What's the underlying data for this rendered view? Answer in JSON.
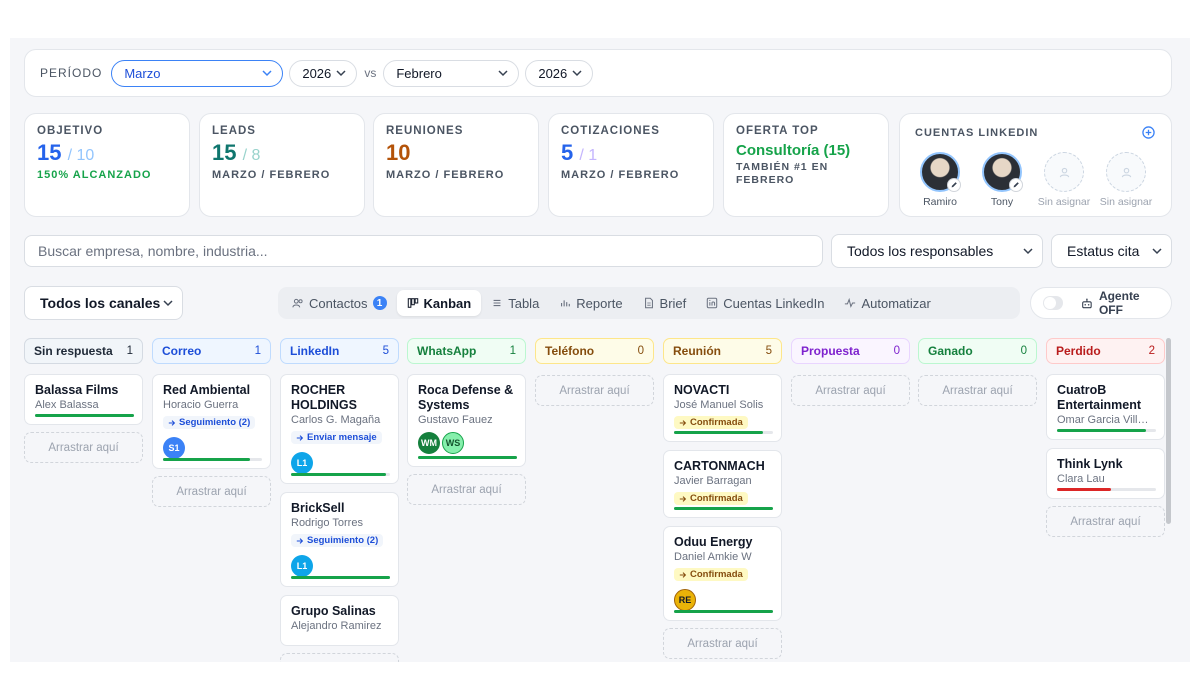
{
  "period": {
    "label": "PERÍODO",
    "month": "Marzo",
    "year": "2026",
    "vs": "vs",
    "compare_month": "Febrero",
    "compare_year": "2026"
  },
  "kpis": {
    "objetivo": {
      "title": "OBJETIVO",
      "value": "15",
      "denominator": "/ 10",
      "sub": "150% ALCANZADO"
    },
    "leads": {
      "title": "LEADS",
      "value": "15",
      "denominator": "/ 8",
      "sub": "MARZO / FEBRERO"
    },
    "reuniones": {
      "title": "REUNIONES",
      "value": "10",
      "sub": "MARZO / FEBRERO"
    },
    "cotizaciones": {
      "title": "COTIZACIONES",
      "value": "5",
      "denominator": "/ 1",
      "sub": "MARZO / FEBRERO"
    },
    "oferta": {
      "title": "OFERTA TOP",
      "value": "Consultoría (15)",
      "sub_line1": "TAMBIÉN #1 EN",
      "sub_line2": "FEBRERO"
    }
  },
  "linkedin": {
    "title": "CUENTAS LINKEDIN",
    "accounts": [
      "Ramiro",
      "Tony",
      "Sin asignar",
      "Sin asignar"
    ]
  },
  "search": {
    "placeholder": "Buscar empresa, nombre, industria..."
  },
  "filters": {
    "responsables": "Todos los responsables",
    "estatus": "Estatus cita",
    "canales": "Todos los canales"
  },
  "tabs": [
    {
      "label": "Contactos",
      "badge": "1"
    },
    {
      "label": "Kanban"
    },
    {
      "label": "Tabla"
    },
    {
      "label": "Reporte"
    },
    {
      "label": "Brief"
    },
    {
      "label": "Cuentas LinkedIn"
    },
    {
      "label": "Automatizar"
    }
  ],
  "agent": {
    "label": "Agente OFF"
  },
  "drop_label": "Arrastrar aquí",
  "colors": {
    "accent": "#3b82f6",
    "green": "#16a34a",
    "red": "#dc2626"
  },
  "columns": [
    {
      "name": "Sin respuesta",
      "count": "1",
      "cards": [
        {
          "title": "Balassa Films",
          "sub": "Alex Balassa",
          "progress": 1.0,
          "bar": "#16a34a"
        }
      ]
    },
    {
      "name": "Correo",
      "count": "1",
      "cards": [
        {
          "title": "Red Ambiental",
          "sub": "Horacio Guerra",
          "tag": "Seguimiento (2)",
          "chips": [
            "S1"
          ],
          "progress": 0.88,
          "bar": "#16a34a"
        }
      ]
    },
    {
      "name": "LinkedIn",
      "count": "5",
      "cards": [
        {
          "title": "ROCHER HOLDINGS",
          "sub": "Carlos G. Magaña",
          "tag": "Enviar mensaje",
          "chips": [
            "L1"
          ],
          "progress": 0.96,
          "bar": "#16a34a"
        },
        {
          "title": "BrickSell",
          "sub": "Rodrigo Torres",
          "tag": "Seguimiento (2)",
          "chips": [
            "L1"
          ],
          "progress": 1.0,
          "bar": "#16a34a"
        },
        {
          "title": "Grupo Salinas",
          "sub": "Alejandro Ramirez"
        }
      ]
    },
    {
      "name": "WhatsApp",
      "count": "1",
      "cards": [
        {
          "title": "Roca Defense & Systems",
          "sub": "Gustavo Fauez",
          "chips": [
            "WM",
            "WS"
          ],
          "progress": 1.0,
          "bar": "#16a34a"
        }
      ]
    },
    {
      "name": "Teléfono",
      "count": "0",
      "cards": []
    },
    {
      "name": "Reunión",
      "count": "5",
      "cards": [
        {
          "title": "NOVACTI",
          "sub": "José Manuel Solis",
          "tag": "Confirmada",
          "tagColor": "yellow",
          "progress": 0.9,
          "bar": "#16a34a"
        },
        {
          "title": "CARTONMACH",
          "sub": "Javier Barragan",
          "tag": "Confirmada",
          "tagColor": "yellow",
          "progress": 1.0,
          "bar": "#16a34a"
        },
        {
          "title": "Oduu Energy",
          "sub": "Daniel Amkie W",
          "tag": "Confirmada",
          "tagColor": "yellow",
          "chips": [
            "RE"
          ],
          "progress": 1.0,
          "bar": "#16a34a"
        }
      ]
    },
    {
      "name": "Propuesta",
      "count": "0",
      "cards": []
    },
    {
      "name": "Ganado",
      "count": "0",
      "cards": []
    },
    {
      "name": "Perdido",
      "count": "2",
      "cards": [
        {
          "title": "CuatroB Entertainment",
          "sub": "Omar Garcia Villarreal",
          "progress": 0.9,
          "bar": "#16a34a"
        },
        {
          "title": "Think Lynk",
          "sub": "Clara Lau",
          "progress": 0.55,
          "bar": "#dc2626"
        }
      ]
    }
  ]
}
